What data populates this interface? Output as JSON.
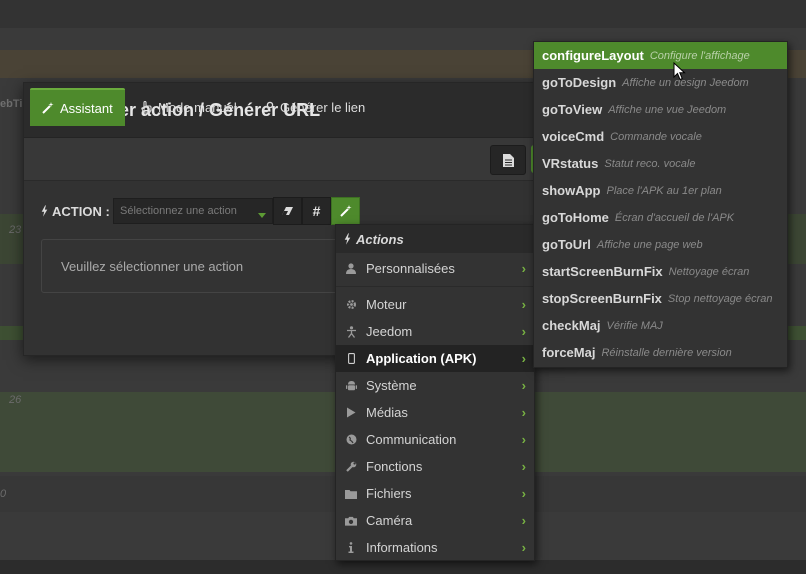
{
  "background": {
    "left_fragments": [
      "ebTi",
      "23",
      "26",
      "0"
    ]
  },
  "modal": {
    "title": "Exécuter action / Générer URL",
    "tabs": [
      {
        "label": "Assistant",
        "icon": "magic-wand-icon"
      },
      {
        "label": "Mode manuel",
        "icon": "pointer-hand-icon"
      },
      {
        "label": "Générer le lien",
        "icon": "link-icon"
      }
    ],
    "action_label": "ACTION :",
    "action_select_placeholder": "Sélectionnez une action",
    "info_message": "Veuillez sélectionner une action",
    "accent_color": "#4e8a2c"
  },
  "categories_menu": {
    "header": "Actions",
    "items": [
      {
        "label": "Personnalisées",
        "icon": "user-icon"
      },
      {
        "label": "Moteur",
        "icon": "gear-icon"
      },
      {
        "label": "Jeedom",
        "icon": "accessibility-icon"
      },
      {
        "label": "Application (APK)",
        "icon": "mobile-icon",
        "active": true
      },
      {
        "label": "Système",
        "icon": "android-icon"
      },
      {
        "label": "Médias",
        "icon": "play-icon"
      },
      {
        "label": "Communication",
        "icon": "globe-icon"
      },
      {
        "label": "Fonctions",
        "icon": "wrench-icon"
      },
      {
        "label": "Fichiers",
        "icon": "folder-icon"
      },
      {
        "label": "Caméra",
        "icon": "camera-icon"
      },
      {
        "label": "Informations",
        "icon": "info-icon"
      }
    ]
  },
  "submenu": {
    "items": [
      {
        "cmd": "configureLayout",
        "desc": "Configure l'affichage",
        "active": true
      },
      {
        "cmd": "goToDesign",
        "desc": "Affiche un design Jeedom"
      },
      {
        "cmd": "goToView",
        "desc": "Affiche une vue Jeedom"
      },
      {
        "cmd": "voiceCmd",
        "desc": "Commande vocale"
      },
      {
        "cmd": "VRstatus",
        "desc": "Statut reco. vocale"
      },
      {
        "cmd": "showApp",
        "desc": "Place l'APK au 1er plan"
      },
      {
        "cmd": "goToHome",
        "desc": "Écran d'accueil de l'APK"
      },
      {
        "cmd": "goToUrl",
        "desc": "Affiche une page web"
      },
      {
        "cmd": "startScreenBurnFix",
        "desc": "Nettoyage écran"
      },
      {
        "cmd": "stopScreenBurnFix",
        "desc": "Stop nettoyage écran"
      },
      {
        "cmd": "checkMaj",
        "desc": "Vérifie MAJ"
      },
      {
        "cmd": "forceMaj",
        "desc": "Réinstalle dernière version"
      }
    ]
  }
}
